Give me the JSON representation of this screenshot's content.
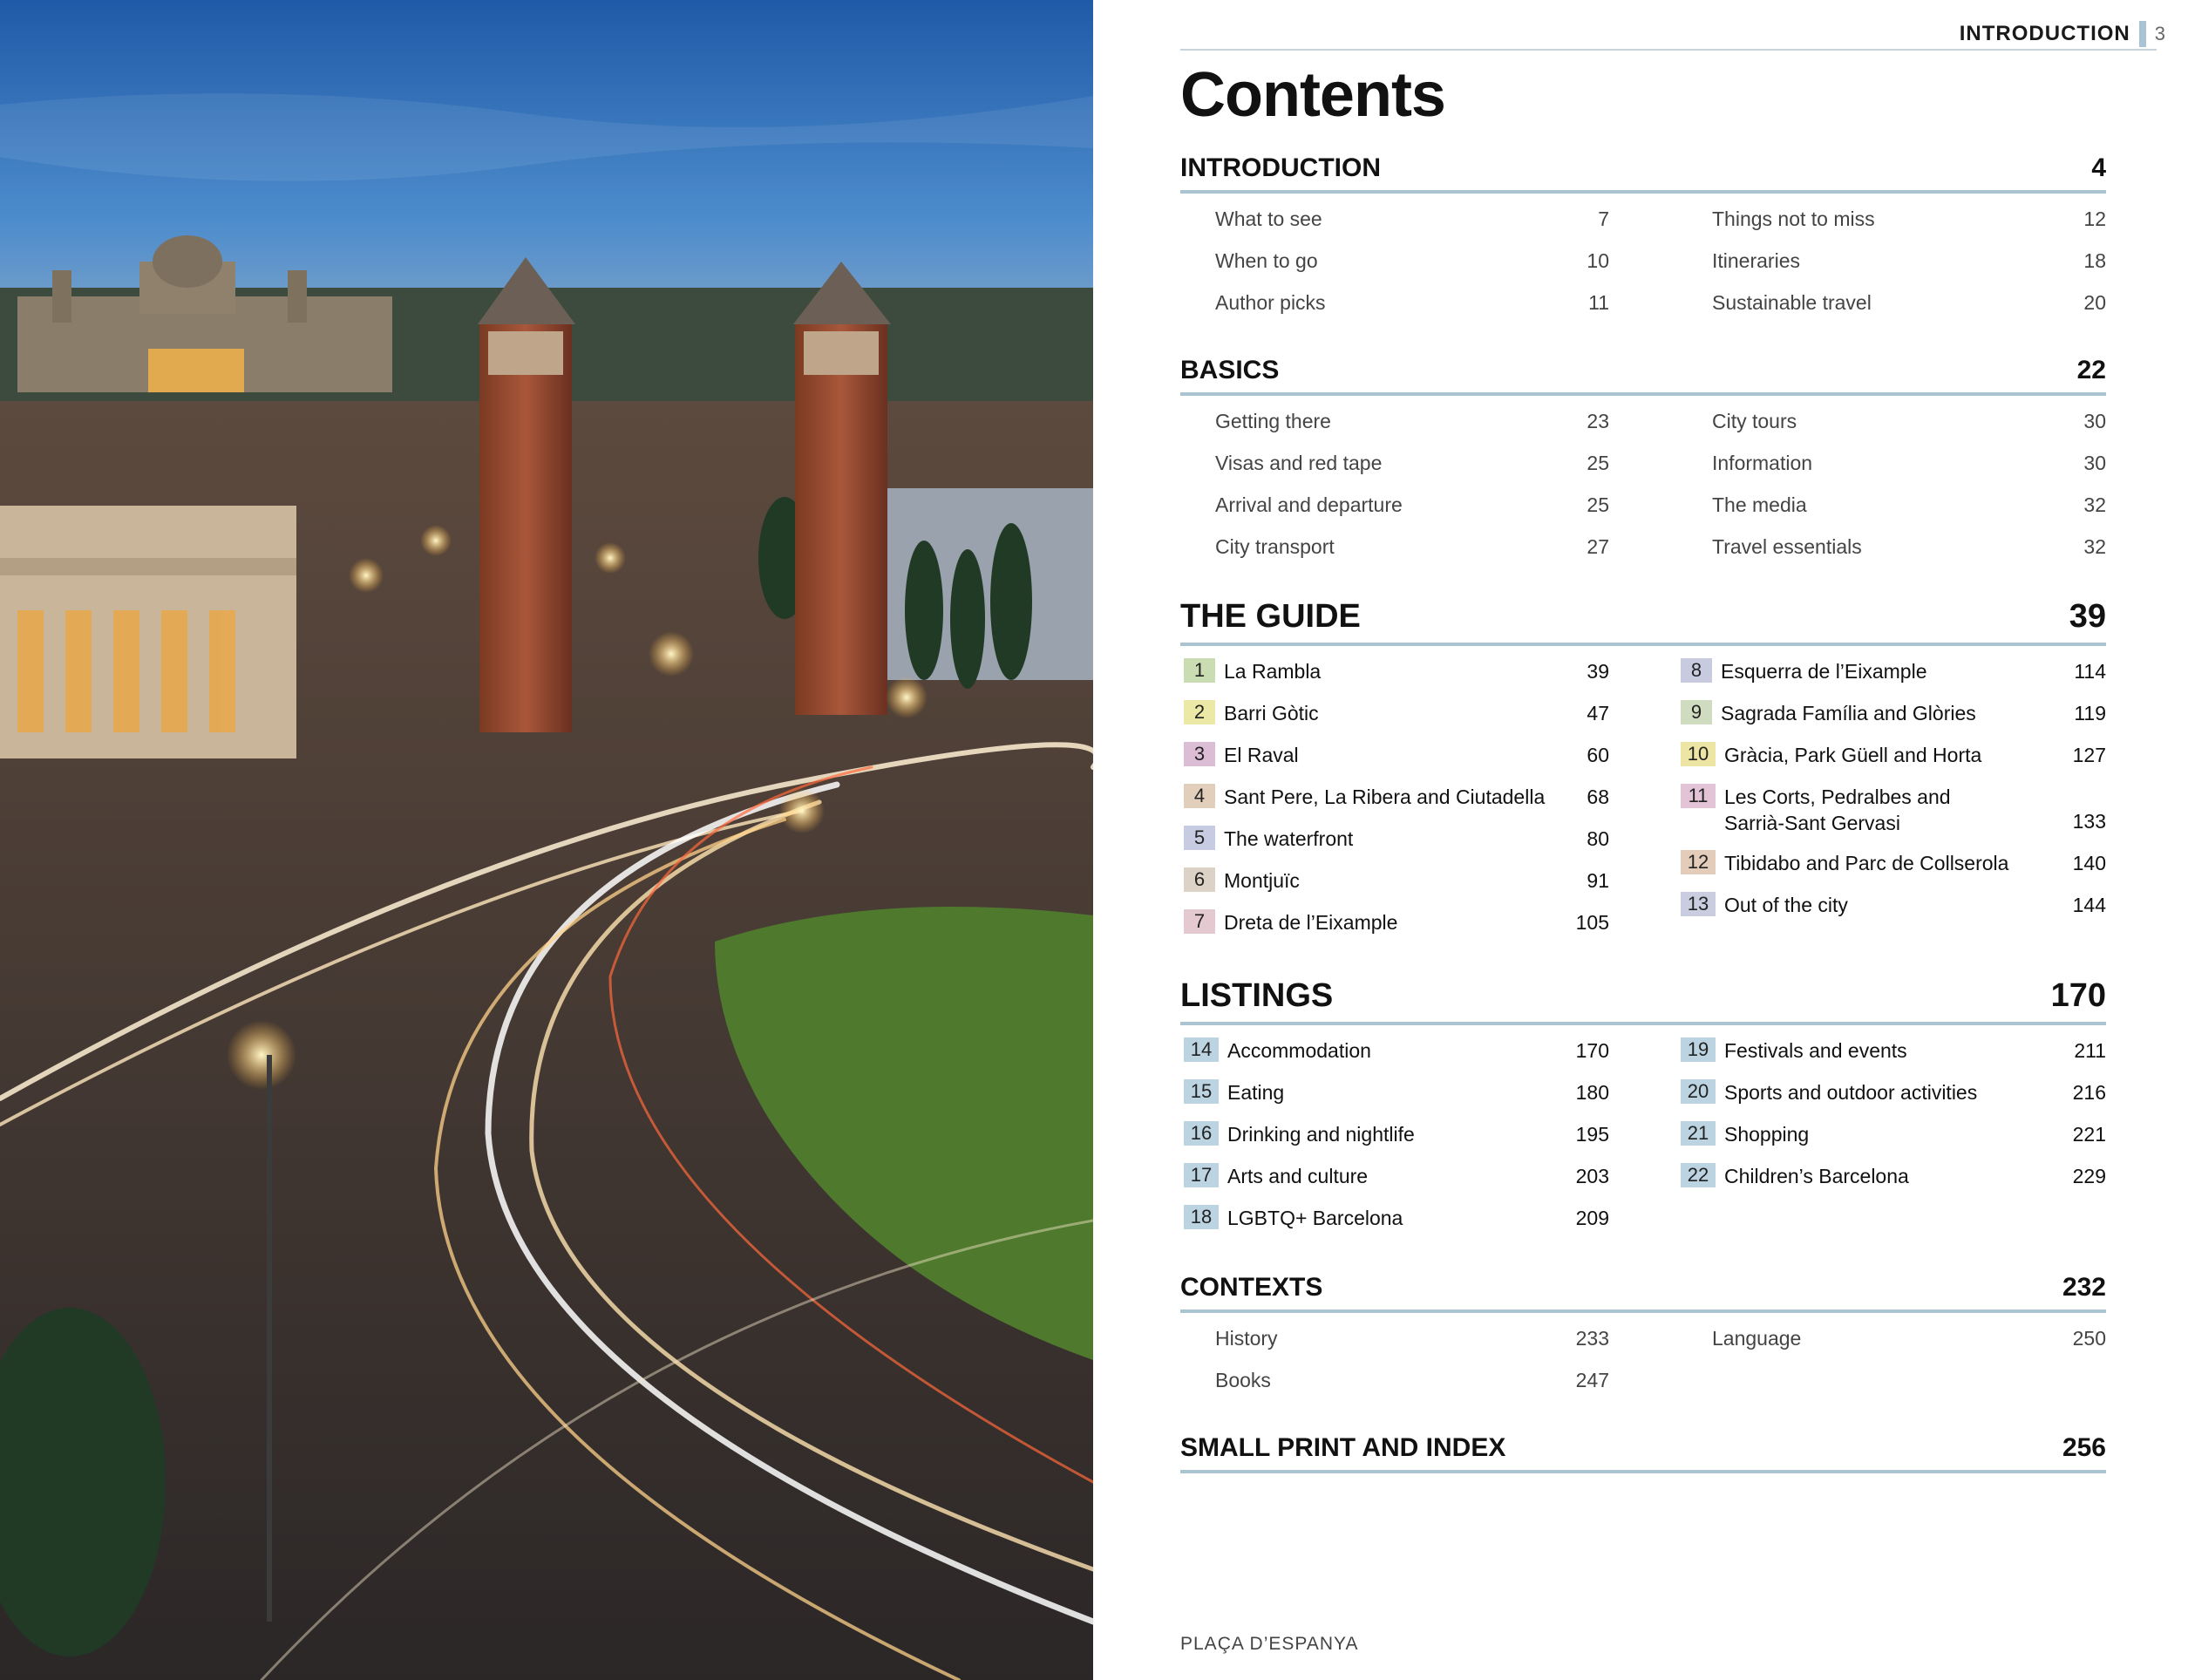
{
  "running_head": {
    "section": "INTRODUCTION",
    "folio": "3"
  },
  "title": "Contents",
  "caption": "PLAÇA D’ESPANYA",
  "sections": {
    "introduction": {
      "name": "INTRODUCTION",
      "page": "4",
      "left": [
        {
          "label": "What to see",
          "page": "7"
        },
        {
          "label": "When to go",
          "page": "10"
        },
        {
          "label": "Author picks",
          "page": "11"
        }
      ],
      "right": [
        {
          "label": "Things not to miss",
          "page": "12"
        },
        {
          "label": "Itineraries",
          "page": "18"
        },
        {
          "label": "Sustainable travel",
          "page": "20"
        }
      ]
    },
    "basics": {
      "name": "BASICS",
      "page": "22",
      "left": [
        {
          "label": "Getting there",
          "page": "23"
        },
        {
          "label": "Visas and red tape",
          "page": "25"
        },
        {
          "label": "Arrival and departure",
          "page": "25"
        },
        {
          "label": "City transport",
          "page": "27"
        }
      ],
      "right": [
        {
          "label": "City tours",
          "page": "30"
        },
        {
          "label": "Information",
          "page": "30"
        },
        {
          "label": "The media",
          "page": "32"
        },
        {
          "label": "Travel essentials",
          "page": "32"
        }
      ]
    },
    "guide": {
      "name": "THE GUIDE",
      "page": "39",
      "left": [
        {
          "num": "1",
          "label": "La Rambla",
          "page": "39",
          "color": "#c9dcb2"
        },
        {
          "num": "2",
          "label": "Barri Gòtic",
          "page": "47",
          "color": "#ece9a6"
        },
        {
          "num": "3",
          "label": "El Raval",
          "page": "60",
          "color": "#dcbdd6"
        },
        {
          "num": "4",
          "label": "Sant Pere, La Ribera and Ciutadella",
          "page": "68",
          "color": "#e2cfbb"
        },
        {
          "num": "5",
          "label": "The waterfront",
          "page": "80",
          "color": "#c8cce2"
        },
        {
          "num": "6",
          "label": "Montjuïc",
          "page": "91",
          "color": "#ddd2c6"
        },
        {
          "num": "7",
          "label": "Dreta de l’Eixample",
          "page": "105",
          "color": "#e4c9d0"
        }
      ],
      "right": [
        {
          "num": "8",
          "label": "Esquerra de l’Eixample",
          "page": "114",
          "color": "#c8cbe0"
        },
        {
          "num": "9",
          "label": "Sagrada Família and Glòries",
          "page": "119",
          "color": "#cfdcc0"
        },
        {
          "num": "10",
          "label": "Gràcia, Park Güell and Horta",
          "page": "127",
          "color": "#ece5a4"
        },
        {
          "num": "11",
          "label": "Les Corts, Pedralbes and\nSarrià-Sant Gervasi",
          "page": "133",
          "color": "#e2c4d6"
        },
        {
          "num": "12",
          "label": "Tibidabo and Parc de Collserola",
          "page": "140",
          "color": "#e4ccba"
        },
        {
          "num": "13",
          "label": "Out of the city",
          "page": "144",
          "color": "#cacde0"
        }
      ]
    },
    "listings": {
      "name": "LISTINGS",
      "page": "170",
      "left": [
        {
          "num": "14",
          "label": "Accommodation",
          "page": "170",
          "color": "#bcd3e2"
        },
        {
          "num": "15",
          "label": "Eating",
          "page": "180",
          "color": "#bcd3e2"
        },
        {
          "num": "16",
          "label": "Drinking and nightlife",
          "page": "195",
          "color": "#bcd3e2"
        },
        {
          "num": "17",
          "label": "Arts and culture",
          "page": "203",
          "color": "#bcd3e2"
        },
        {
          "num": "18",
          "label": "LGBTQ+ Barcelona",
          "page": "209",
          "color": "#bcd3e2"
        }
      ],
      "right": [
        {
          "num": "19",
          "label": "Festivals and events",
          "page": "211",
          "color": "#bcd3e2"
        },
        {
          "num": "20",
          "label": "Sports and outdoor activities",
          "page": "216",
          "color": "#bcd3e2"
        },
        {
          "num": "21",
          "label": "Shopping",
          "page": "221",
          "color": "#bcd3e2"
        },
        {
          "num": "22",
          "label": "Children’s Barcelona",
          "page": "229",
          "color": "#bcd3e2"
        }
      ]
    },
    "contexts": {
      "name": "CONTEXTS",
      "page": "232",
      "left": [
        {
          "label": "History",
          "page": "233"
        },
        {
          "label": "Books",
          "page": "247"
        }
      ],
      "right": [
        {
          "label": "Language",
          "page": "250"
        }
      ]
    },
    "small_print": {
      "name": "SMALL PRINT AND INDEX",
      "page": "256"
    }
  },
  "colors": {
    "rule": "#aac4d2",
    "listings_badge": "#bcd3e2"
  }
}
